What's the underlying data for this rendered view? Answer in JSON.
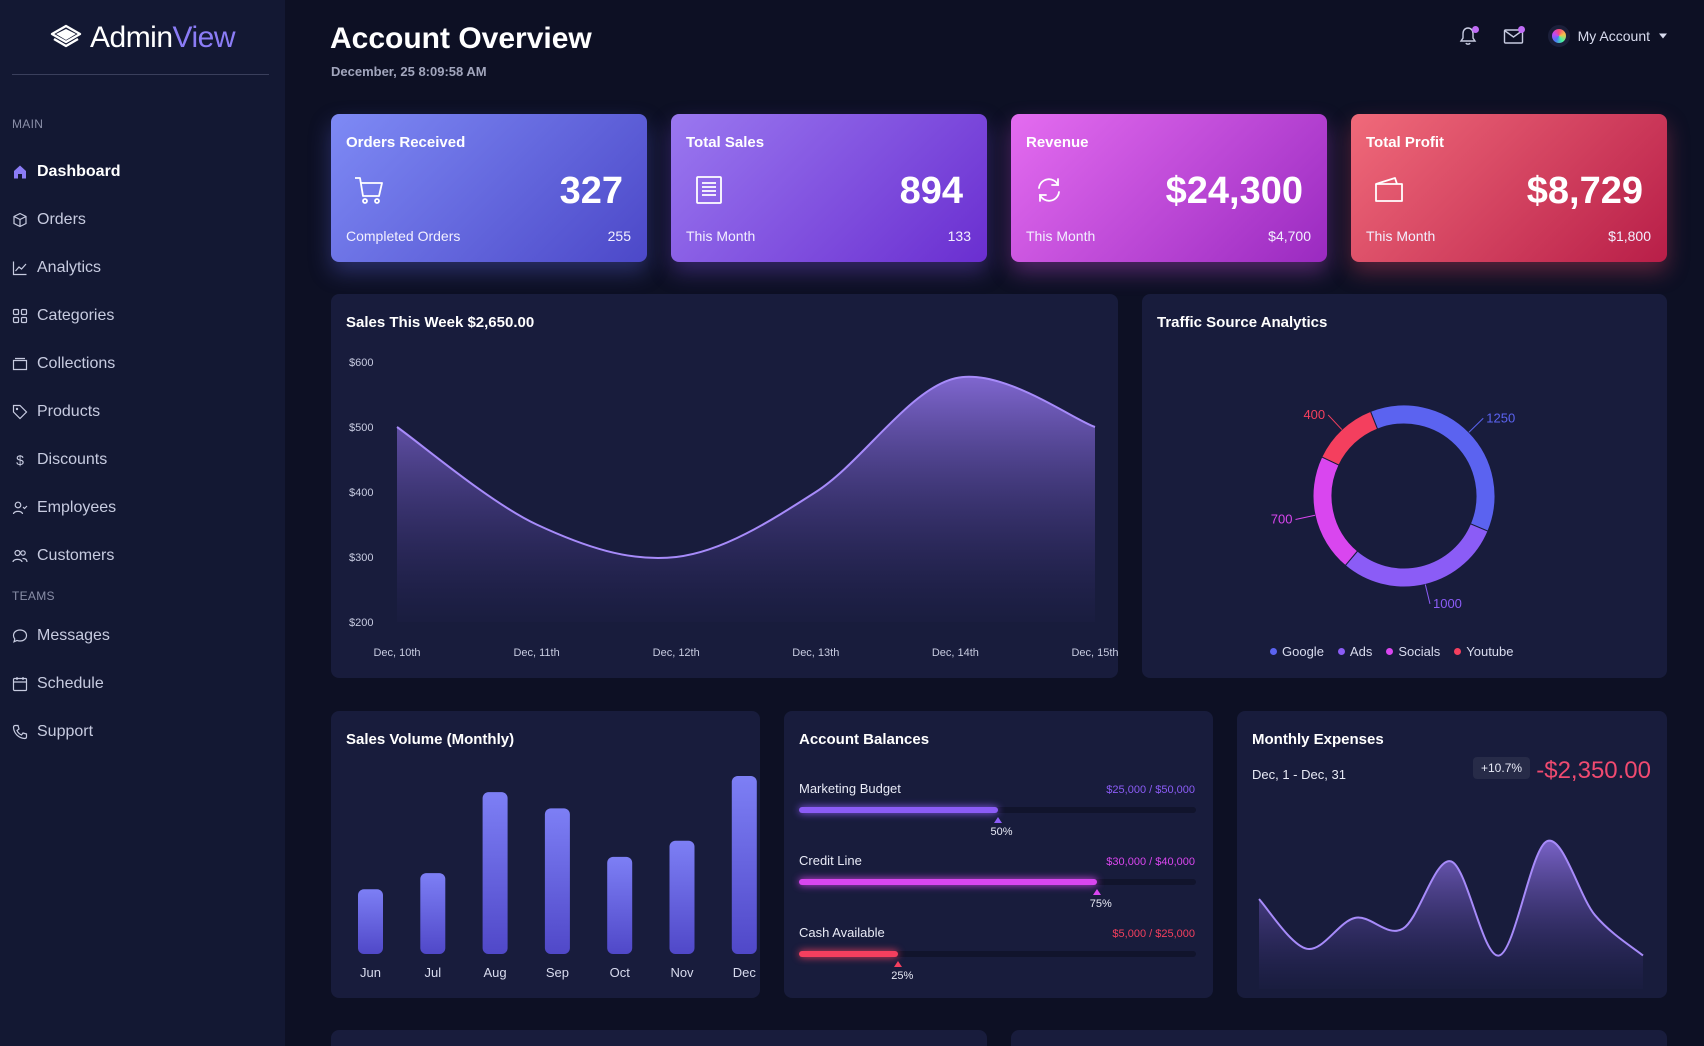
{
  "app": {
    "name_part1": "Admin",
    "name_part2": "View"
  },
  "sidebar": {
    "section_main": "MAIN",
    "section_teams": "TEAMS",
    "items": [
      {
        "label": "Dashboard",
        "icon": "home-icon",
        "active": true
      },
      {
        "label": "Orders",
        "icon": "box-icon"
      },
      {
        "label": "Analytics",
        "icon": "trend-icon"
      },
      {
        "label": "Categories",
        "icon": "grid-icon"
      },
      {
        "label": "Collections",
        "icon": "folder-icon"
      },
      {
        "label": "Products",
        "icon": "tag-icon"
      },
      {
        "label": "Discounts",
        "icon": "dollar-icon"
      },
      {
        "label": "Employees",
        "icon": "user-check-icon"
      },
      {
        "label": "Customers",
        "icon": "users-icon"
      }
    ],
    "team_items": [
      {
        "label": "Messages",
        "icon": "chat-icon"
      },
      {
        "label": "Schedule",
        "icon": "calendar-icon"
      },
      {
        "label": "Support",
        "icon": "phone-icon"
      }
    ]
  },
  "header": {
    "title": "Account Overview",
    "date": "December, 25 8:09:58 AM",
    "account_label": "My Account"
  },
  "stats": [
    {
      "title": "Orders Received",
      "value": "327",
      "sub_label": "Completed Orders",
      "sub_value": "255",
      "icon": "cart-icon"
    },
    {
      "title": "Total Sales",
      "value": "894",
      "sub_label": "This Month",
      "sub_value": "133",
      "icon": "receipt-icon"
    },
    {
      "title": "Revenue",
      "value": "$24,300",
      "sub_label": "This Month",
      "sub_value": "$4,700",
      "icon": "refresh-icon"
    },
    {
      "title": "Total Profit",
      "value": "$8,729",
      "sub_label": "This Month",
      "sub_value": "$1,800",
      "icon": "wallet-icon"
    }
  ],
  "sales_week": {
    "title": "Sales This Week $2,650.00"
  },
  "traffic": {
    "title": "Traffic Source Analytics"
  },
  "sales_volume": {
    "title": "Sales Volume (Monthly)"
  },
  "balances": {
    "title": "Account Balances",
    "items": [
      {
        "label": "Marketing Budget",
        "value": "$25,000 / $50,000",
        "percent": 50,
        "pct_label": "50%",
        "color": "#8b5cf6"
      },
      {
        "label": "Credit Line",
        "value": "$30,000 / $40,000",
        "percent": 75,
        "pct_label": "75%",
        "color": "#d946ef"
      },
      {
        "label": "Cash Available",
        "value": "$5,000 / $25,000",
        "percent": 25,
        "pct_label": "25%",
        "color": "#f43f5e"
      }
    ]
  },
  "expenses": {
    "title": "Monthly Expenses",
    "range": "Dec, 1 - Dec, 31",
    "change": "+10.7%",
    "amount": "-$2,350.00"
  },
  "chart_data": [
    {
      "type": "area",
      "x": [
        "Dec, 10th",
        "Dec, 11th",
        "Dec, 12th",
        "Dec, 13th",
        "Dec, 14th",
        "Dec, 15th"
      ],
      "y": [
        500,
        350,
        300,
        400,
        575,
        500
      ],
      "ylim": [
        200,
        600
      ],
      "yticks": [
        "$600",
        "$500",
        "$400",
        "$300",
        "$200"
      ],
      "grid": false
    },
    {
      "type": "pie",
      "categories": [
        "Google",
        "Ads",
        "Socials",
        "Youtube"
      ],
      "values": [
        1250,
        1000,
        700,
        400
      ],
      "colors": [
        "#5b63f0",
        "#8b5cf6",
        "#d946ef",
        "#f43f5e"
      ],
      "legend": "bottom"
    },
    {
      "type": "bar",
      "categories": [
        "Jun",
        "Jul",
        "Aug",
        "Sep",
        "Oct",
        "Nov",
        "Dec"
      ],
      "values": [
        40,
        50,
        100,
        90,
        60,
        70,
        110
      ],
      "color": "#6b6af0"
    },
    {
      "type": "area",
      "y": [
        52,
        15,
        38,
        30,
        80,
        10,
        95,
        40,
        10
      ],
      "ylim": [
        0,
        110
      ],
      "grid": false
    }
  ]
}
